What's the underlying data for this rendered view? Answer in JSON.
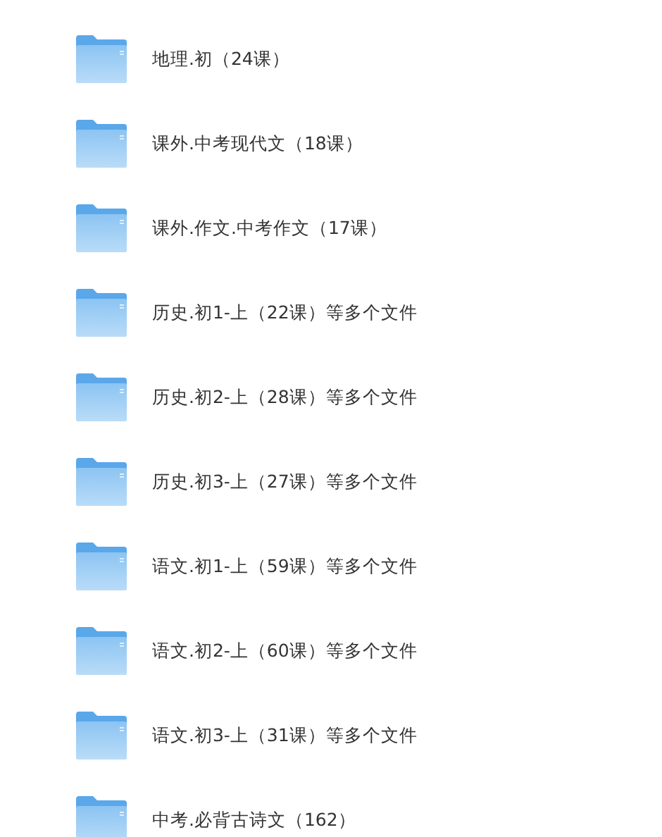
{
  "folders": [
    {
      "name": "地理.初（24课）"
    },
    {
      "name": "课外.中考现代文（18课）"
    },
    {
      "name": "课外.作文.中考作文（17课）"
    },
    {
      "name": "历史.初1-上（22课）等多个文件"
    },
    {
      "name": "历史.初2-上（28课）等多个文件"
    },
    {
      "name": "历史.初3-上（27课）等多个文件"
    },
    {
      "name": "语文.初1-上（59课）等多个文件"
    },
    {
      "name": "语文.初2-上（60课）等多个文件"
    },
    {
      "name": "语文.初3-上（31课）等多个文件"
    },
    {
      "name": "中考.必背古诗文（162）"
    }
  ]
}
